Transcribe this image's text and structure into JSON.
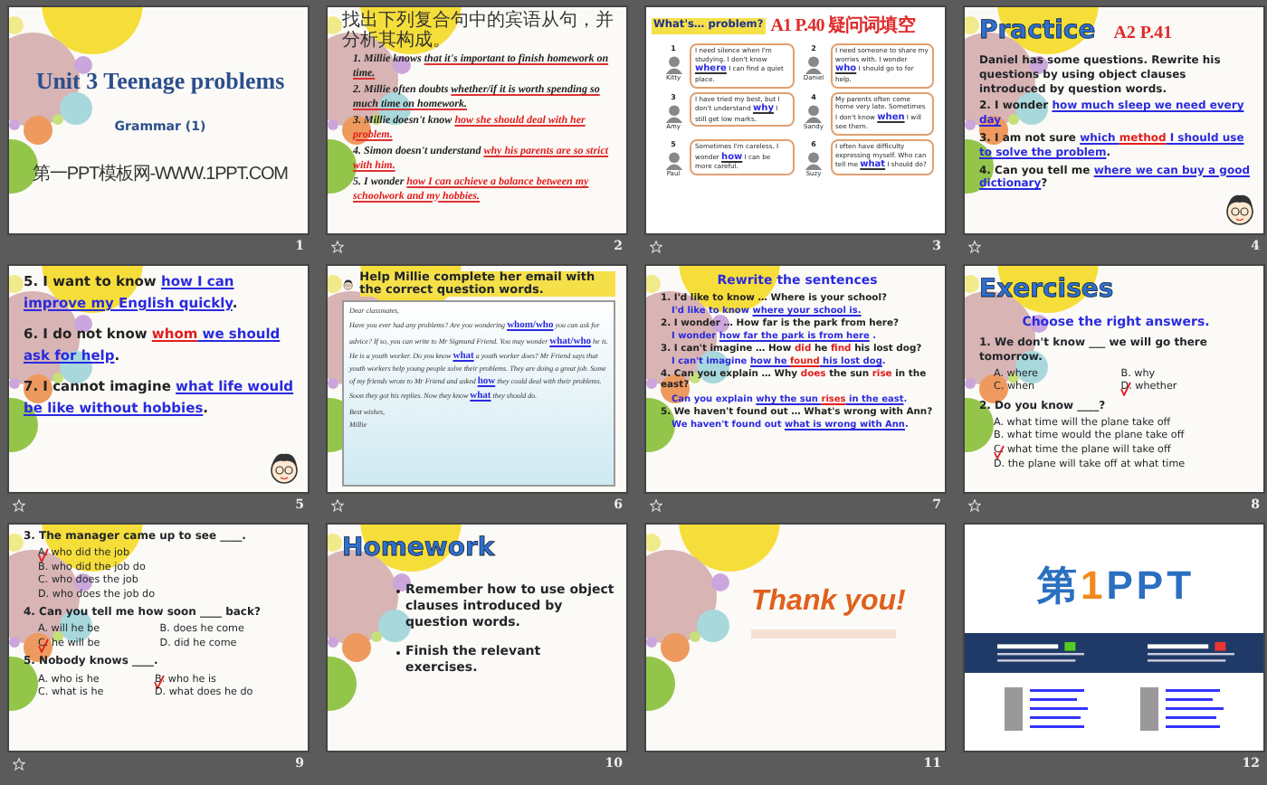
{
  "slides": [
    {
      "number": "1",
      "animated": false,
      "bubbles": true,
      "blocks": [
        {
          "kind": "title",
          "text": "Unit 3 Teenage problems"
        },
        {
          "kind": "subtitle",
          "text": "Grammar (1)"
        },
        {
          "kind": "footnote",
          "text": "第一PPT模板网-WWW.1PPT.COM"
        }
      ]
    },
    {
      "number": "2",
      "animated": true,
      "bubbles": true,
      "blocks": [
        {
          "kind": "instruction",
          "text": "找出下列复合句中的宾语从句，并分析其构成。"
        },
        {
          "kind": "sentence",
          "segments": [
            {
              "text": "1. Millie knows "
            },
            {
              "text": "that it's important to finish homework on time.",
              "underline": true
            }
          ]
        },
        {
          "kind": "sentence",
          "segments": [
            {
              "text": "2. Millie often doubts "
            },
            {
              "text": "whether/if it is worth spending so much time on homework.",
              "underline": true
            }
          ]
        },
        {
          "kind": "sentence",
          "segments": [
            {
              "text": "3. Millie doesn't know "
            },
            {
              "text": "how she should deal with her problem.",
              "color": "#e31c1c",
              "underline": true
            }
          ]
        },
        {
          "kind": "sentence",
          "segments": [
            {
              "text": "4. Simon doesn't understand "
            },
            {
              "text": "why his parents are so strict with him.",
              "color": "#e31c1c",
              "underline": true
            }
          ]
        },
        {
          "kind": "sentence",
          "segments": [
            {
              "text": "5. I wonder "
            },
            {
              "text": "how I can achieve a balance between my schoolwork and my hobbies.",
              "color": "#e31c1c",
              "underline": true
            }
          ]
        }
      ]
    },
    {
      "number": "3",
      "animated": true,
      "bubbles": false,
      "blocks": [
        {
          "kind": "banner",
          "text": "What's… problem?",
          "note": "A1 P.40 疑问词填空"
        },
        {
          "kind": "dialogs",
          "items": [
            {
              "number": "1",
              "name": "Kitty",
              "before": "I need silence when I'm studying. I don't know",
              "answer": "where",
              "after": "I can find a quiet place."
            },
            {
              "number": "2",
              "name": "Daniel",
              "before": "I need someone to share my worries with. I wonder",
              "answer": "who",
              "after": "I should go to for help."
            },
            {
              "number": "3",
              "name": "Amy",
              "before": "I have tried my best, but I don't understand",
              "answer": "why",
              "after": "I still get low marks."
            },
            {
              "number": "4",
              "name": "Sandy",
              "before": "My parents often come home very late. Sometimes I don't know",
              "answer": "when",
              "after": "I will see them."
            },
            {
              "number": "5",
              "name": "Paul",
              "before": "Sometimes I'm careless. I wonder",
              "answer": "how",
              "after": "I can be more careful."
            },
            {
              "number": "6",
              "name": "Suzy",
              "before": "I often have difficulty expressing myself. Who can tell me",
              "answer": "what",
              "after": "I should do?"
            }
          ]
        }
      ]
    },
    {
      "number": "4",
      "animated": true,
      "bubbles": true,
      "blocks": [
        {
          "kind": "heading",
          "text": "Practice",
          "note": "A2 P.41"
        },
        {
          "kind": "paragraph",
          "text": "Daniel has some questions. Rewrite his questions by using object clauses introduced by question words."
        },
        {
          "kind": "line",
          "segments": [
            {
              "text": "2. I wonder "
            },
            {
              "text": "how much sleep we need every day",
              "color": "#2a2ae0",
              "underline": true
            }
          ]
        },
        {
          "kind": "line",
          "segments": [
            {
              "text": "3. I am not sure "
            },
            {
              "text": "which ",
              "color": "#2a2ae0",
              "underline": true
            },
            {
              "text": "method",
              "color": "#e31c1c",
              "underline": true
            },
            {
              "text": " I should use to solve the problem",
              "color": "#2a2ae0",
              "underline": true
            },
            {
              "text": "."
            }
          ]
        },
        {
          "kind": "line",
          "segments": [
            {
              "text": "4. Can you tell me "
            },
            {
              "text": "where we can buy a good dictionary",
              "color": "#2a2ae0",
              "underline": true
            },
            {
              "text": "?"
            }
          ]
        },
        {
          "kind": "cartoon"
        }
      ]
    },
    {
      "number": "5",
      "animated": true,
      "bubbles": true,
      "blocks": [
        {
          "kind": "line",
          "segments": [
            {
              "text": "5. I want to know "
            },
            {
              "text": "how I can improve my English quickly",
              "color": "#2a2ae0",
              "underline": true
            },
            {
              "text": "."
            }
          ]
        },
        {
          "kind": "line",
          "segments": [
            {
              "text": "6. I do not know "
            },
            {
              "text": "whom",
              "color": "#e31c1c",
              "underline": true
            },
            {
              "text": " we should ask for help",
              "color": "#2a2ae0",
              "underline": true
            },
            {
              "text": "."
            }
          ]
        },
        {
          "kind": "line",
          "segments": [
            {
              "text": "7. I cannot imagine "
            },
            {
              "text": "what life would be like without hobbies",
              "color": "#2a2ae0",
              "underline": true
            },
            {
              "text": "."
            }
          ]
        },
        {
          "kind": "cartoon"
        }
      ]
    },
    {
      "number": "6",
      "animated": true,
      "bubbles": true,
      "blocks": [
        {
          "kind": "helper",
          "text": "Help Millie complete her email with the correct question words."
        },
        {
          "kind": "email",
          "greeting": "Dear classmates,",
          "body": [
            {
              "text": "Have you ever had any problems? Are you wondering "
            },
            {
              "text": "whom/who",
              "color": "#2a2ae0",
              "underline": true
            },
            {
              "text": " you can ask for advice? If so, you can write to Mr Sigmund Friend. You may wonder "
            },
            {
              "text": "what/who",
              "color": "#2a2ae0",
              "underline": true
            },
            {
              "text": " he is. He is a youth worker. Do you know "
            },
            {
              "text": "what",
              "color": "#2a2ae0",
              "underline": true
            },
            {
              "text": " a youth worker does? Mr Friend says that youth workers help young people solve their problems. They are doing a great job. Some of my friends wrote to Mr Friend and asked "
            },
            {
              "text": "how",
              "color": "#2a2ae0",
              "underline": true
            },
            {
              "text": " they could deal with their problems. Soon they got his replies. Now they know "
            },
            {
              "text": "what",
              "color": "#2a2ae0",
              "underline": true
            },
            {
              "text": " they should do."
            }
          ],
          "closing": "Best wishes,",
          "signature": "Millie"
        }
      ]
    },
    {
      "number": "7",
      "animated": true,
      "bubbles": true,
      "blocks": [
        {
          "kind": "caption",
          "text": "Rewrite the sentences"
        },
        {
          "kind": "line",
          "segments": [
            {
              "text": "1. I'd like to know … Where is your school?"
            }
          ]
        },
        {
          "kind": "answer",
          "segments": [
            {
              "text": "I'd like to know "
            },
            {
              "text": "where your school is.",
              "underline": true
            }
          ]
        },
        {
          "kind": "line",
          "segments": [
            {
              "text": "2. I wonder … How far is the park from here?"
            }
          ]
        },
        {
          "kind": "answer",
          "segments": [
            {
              "text": "I wonder "
            },
            {
              "text": "how far the park is from here",
              "underline": true
            },
            {
              "text": " ."
            }
          ]
        },
        {
          "kind": "line",
          "segments": [
            {
              "text": "3. I can't imagine … How "
            },
            {
              "text": "did",
              "color": "#e31c1c"
            },
            {
              "text": " he "
            },
            {
              "text": "find",
              "color": "#e31c1c"
            },
            {
              "text": " his lost dog?"
            }
          ]
        },
        {
          "kind": "answer",
          "segments": [
            {
              "text": "I can't imagine "
            },
            {
              "text": "how he ",
              "underline": true
            },
            {
              "text": "found",
              "color": "#e31c1c",
              "underline": true
            },
            {
              "text": " his lost dog",
              "underline": true
            },
            {
              "text": "."
            }
          ]
        },
        {
          "kind": "line",
          "segments": [
            {
              "text": "4. Can you explain … Why "
            },
            {
              "text": "does",
              "color": "#e31c1c"
            },
            {
              "text": " the sun "
            },
            {
              "text": "rise",
              "color": "#e31c1c"
            },
            {
              "text": " in the east?"
            }
          ]
        },
        {
          "kind": "answer",
          "segments": [
            {
              "text": "Can you explain "
            },
            {
              "text": "why the sun ",
              "underline": true
            },
            {
              "text": "rises",
              "color": "#e31c1c",
              "underline": true
            },
            {
              "text": " in the east",
              "underline": true
            },
            {
              "text": "."
            }
          ]
        },
        {
          "kind": "line",
          "segments": [
            {
              "text": "5. We haven't found out … What's wrong with Ann?"
            }
          ]
        },
        {
          "kind": "answer",
          "segments": [
            {
              "text": "We haven't found out "
            },
            {
              "text": "what is wrong with Ann",
              "underline": true
            },
            {
              "text": "."
            }
          ]
        }
      ]
    },
    {
      "number": "8",
      "animated": true,
      "bubbles": true,
      "blocks": [
        {
          "kind": "heading",
          "text": "Exercises"
        },
        {
          "kind": "caption",
          "text": "Choose the right answers."
        },
        {
          "kind": "question",
          "text": "1. We don't know ___ we will go there tomorrow.",
          "two_columns": true,
          "options": [
            {
              "label": "A. where",
              "checked": false
            },
            {
              "label": "B. why",
              "checked": false
            },
            {
              "label": "C. when",
              "checked": false
            },
            {
              "label": "D. whether",
              "checked": true
            }
          ]
        },
        {
          "kind": "question",
          "text": "2. Do you know ____?",
          "two_columns": false,
          "options": [
            {
              "label": "A. what time will the plane take off",
              "checked": false
            },
            {
              "label": "B. what time would the plane take off",
              "checked": false
            },
            {
              "label": "C. what time the plane will take off",
              "checked": true
            },
            {
              "label": "D. the plane will take off at what time",
              "checked": false
            }
          ]
        }
      ]
    },
    {
      "number": "9",
      "animated": true,
      "bubbles": true,
      "blocks": [
        {
          "kind": "question",
          "text": "3. The manager came up to see ____.",
          "two_columns": false,
          "options": [
            {
              "label": "A. who did the job",
              "checked": true
            },
            {
              "label": "B. who did the job do",
              "checked": false
            },
            {
              "label": "C. who does the job",
              "checked": false
            },
            {
              "label": "D. who does the job do",
              "checked": false
            }
          ]
        },
        {
          "kind": "question",
          "text": "4. Can you tell me how soon ____ back?",
          "two_columns": true,
          "options": [
            {
              "label": "A. will he be",
              "checked": false
            },
            {
              "label": "B. does he come",
              "checked": false
            },
            {
              "label": "C. he will be",
              "checked": true
            },
            {
              "label": "D. did he come",
              "checked": false
            }
          ]
        },
        {
          "kind": "question",
          "text": "5. Nobody knows ____.",
          "two_columns": true,
          "options": [
            {
              "label": "A. who is he",
              "checked": false
            },
            {
              "label": "B. who he is",
              "checked": true
            },
            {
              "label": "C. what is he",
              "checked": false
            },
            {
              "label": "D. what does he do",
              "checked": false
            }
          ]
        }
      ]
    },
    {
      "number": "10",
      "animated": false,
      "bubbles": true,
      "blocks": [
        {
          "kind": "heading",
          "text": "Homework"
        },
        {
          "kind": "bullet",
          "text": "Remember how to use object clauses introduced by question words."
        },
        {
          "kind": "bullet",
          "text": "Finish the relevant exercises."
        }
      ]
    },
    {
      "number": "11",
      "animated": false,
      "bubbles": true,
      "blocks": [
        {
          "kind": "thanks",
          "text": "Thank you!"
        }
      ]
    },
    {
      "number": "12",
      "animated": false,
      "bubbles": false,
      "blocks": [
        {
          "kind": "brand",
          "logo": [
            {
              "text": "第",
              "color": "#2a6fc0"
            },
            {
              "text": "1",
              "color": "#f08a1c"
            },
            {
              "text": "PPT",
              "color": "#2a6fc0"
            }
          ]
        }
      ]
    }
  ]
}
